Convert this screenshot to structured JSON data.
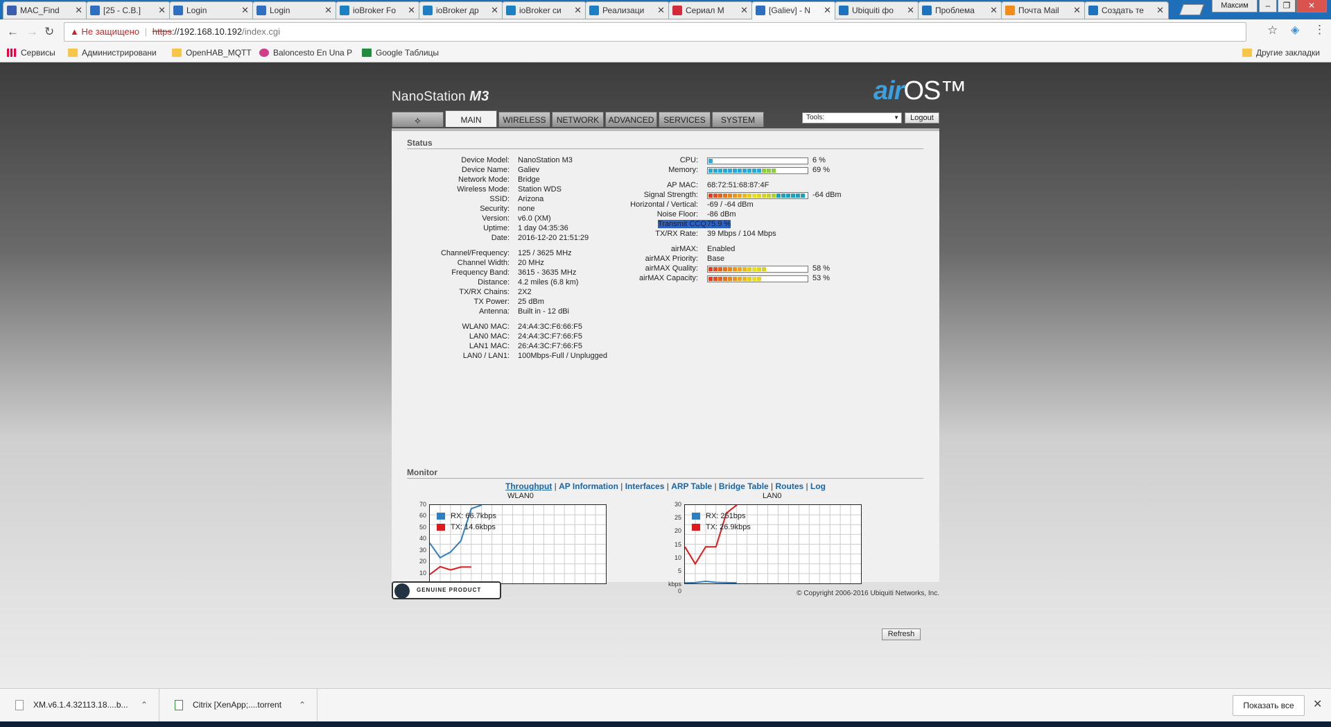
{
  "browser": {
    "tabs": [
      {
        "title": "MAC_Find",
        "icon": "mac-find-icon",
        "color": "#3a5fb0"
      },
      {
        "title": "[25 - C.B.]",
        "icon": "rss-icon",
        "color": "#2e6fc2"
      },
      {
        "title": "Login",
        "icon": "rss-icon",
        "color": "#2e6fc2"
      },
      {
        "title": "Login",
        "icon": "rss-icon",
        "color": "#2e6fc2"
      },
      {
        "title": "ioBroker Fo",
        "icon": "iobroker-icon",
        "color": "#1b80c4"
      },
      {
        "title": "ioBroker др",
        "icon": "iobroker-icon",
        "color": "#1b80c4"
      },
      {
        "title": "ioBroker си",
        "icon": "iobroker-icon",
        "color": "#1b80c4"
      },
      {
        "title": "Реализаци",
        "icon": "iobroker-icon",
        "color": "#1b80c4"
      },
      {
        "title": "Сериал М",
        "icon": "ivi-icon",
        "color": "#d42b3b"
      },
      {
        "title": "[Galiev] - N",
        "icon": "rss-icon",
        "color": "#2e6fc2",
        "active": true
      },
      {
        "title": "Ubiquiti фо",
        "icon": "ubiquiti-icon",
        "color": "#1e73be"
      },
      {
        "title": "Проблема",
        "icon": "ubiquiti-icon",
        "color": "#1e73be"
      },
      {
        "title": "Почта Mail",
        "icon": "mail-icon",
        "color": "#f28c1b"
      },
      {
        "title": "Создать те",
        "icon": "ubiquiti-icon",
        "color": "#1e73be"
      }
    ],
    "user": "Максим",
    "address": {
      "security_label": "Не защищено",
      "scheme": "https",
      "domain": "://192.168.10.192",
      "path": "/index.cgi"
    },
    "bookmarks": [
      {
        "label": "Сервисы",
        "icon": "apps-icon"
      },
      {
        "label": "Администрировани",
        "icon": "folder-icon"
      },
      {
        "label": "OpenHAB_MQTT",
        "icon": "folder-icon"
      },
      {
        "label": "Baloncesto En Una Pl",
        "icon": "basketball-icon"
      },
      {
        "label": "Google Таблицы",
        "icon": "sheets-icon"
      }
    ],
    "other_bookmarks": "Другие закладки"
  },
  "device": {
    "brand_name": "NanoStation",
    "brand_model": "M3",
    "logo_air": "air",
    "logo_os": "OS™",
    "nav_tabs": [
      "MAIN",
      "WIRELESS",
      "NETWORK",
      "ADVANCED",
      "SERVICES",
      "SYSTEM"
    ],
    "tools_label": "Tools:",
    "logout_label": "Logout",
    "status_title": "Status",
    "left_status": [
      {
        "label": "Device Model:",
        "value": "NanoStation M3"
      },
      {
        "label": "Device Name:",
        "value": "Galiev"
      },
      {
        "label": "Network Mode:",
        "value": "Bridge"
      },
      {
        "label": "Wireless Mode:",
        "value": "Station WDS"
      },
      {
        "label": "SSID:",
        "value": "Arizona"
      },
      {
        "label": "Security:",
        "value": "none"
      },
      {
        "label": "Version:",
        "value": "v6.0 (XM)"
      },
      {
        "label": "Uptime:",
        "value": "1 day 04:35:36"
      },
      {
        "label": "Date:",
        "value": "2016-12-20 21:51:29"
      },
      {
        "label": "Channel/Frequency:",
        "value": "125 / 3625 MHz"
      },
      {
        "label": "Channel Width:",
        "value": "20 MHz"
      },
      {
        "label": "Frequency Band:",
        "value": "3615 - 3635 MHz"
      },
      {
        "label": "Distance:",
        "value": "4.2 miles (6.8 km)"
      },
      {
        "label": "TX/RX Chains:",
        "value": "2X2"
      },
      {
        "label": "TX Power:",
        "value": "25 dBm"
      },
      {
        "label": "Antenna:",
        "value": "Built in - 12 dBi"
      },
      {
        "label": "WLAN0 MAC:",
        "value": "24:A4:3C:F6:66:F5"
      },
      {
        "label": "LAN0 MAC:",
        "value": "24:A4:3C:F7:66:F5"
      },
      {
        "label": "LAN1 MAC:",
        "value": "26:A4:3C:F7:66:F5"
      },
      {
        "label": "LAN0 / LAN1:",
        "value": "100Mbps-Full / Unplugged"
      }
    ],
    "right_status": {
      "cpu": {
        "label": "CPU:",
        "text": "6 %",
        "level": 0.06
      },
      "memory": {
        "label": "Memory:",
        "text": "69 %",
        "level": 0.69
      },
      "ap_mac": {
        "label": "AP MAC:",
        "value": "68:72:51:68:87:4F"
      },
      "signal": {
        "label": "Signal Strength:",
        "text": "-64 dBm",
        "level": 1.0
      },
      "hv": {
        "label": "Horizontal / Vertical:",
        "value": "-69 / -64 dBm"
      },
      "noise": {
        "label": "Noise Floor:",
        "value": "-86 dBm"
      },
      "ccq": {
        "label": "Transmit CCQ:",
        "value": "75.9 %"
      },
      "txrx": {
        "label": "TX/RX Rate:",
        "value": "39 Mbps / 104 Mbps"
      },
      "airmax": {
        "label": "airMAX:",
        "value": "Enabled"
      },
      "airmax_priority": {
        "label": "airMAX Priority:",
        "value": "Base"
      },
      "airmax_quality": {
        "label": "airMAX Quality:",
        "text": "58 %",
        "level": 0.58
      },
      "airmax_capacity": {
        "label": "airMAX Capacity:",
        "text": "53 %",
        "level": 0.53
      }
    },
    "monitor_title": "Monitor",
    "monitor_links": [
      "Throughput",
      "AP Information",
      "Interfaces",
      "ARP Table",
      "Bridge Table",
      "Routes",
      "Log"
    ],
    "graphs": [
      {
        "title": "WLAN0",
        "yticks": [
          "70",
          "60",
          "50",
          "40",
          "30",
          "20",
          "10",
          "kbps 0"
        ],
        "ymax": 70,
        "rx_label": "RX: 66.7kbps",
        "tx_label": "TX: 14.6kbps",
        "rx": [
          36,
          23,
          28,
          38,
          66.7,
          70
        ],
        "tx": [
          8,
          15,
          12,
          14.6,
          14.6
        ]
      },
      {
        "title": "LAN0",
        "yticks": [
          "30",
          "25",
          "20",
          "15",
          "10",
          "5",
          "kbps 0"
        ],
        "ymax": 30,
        "rx_label": "RX: 251bps",
        "tx_label": "TX: 26.9kbps",
        "rx": [
          0.2,
          0.3,
          0.8,
          0.4,
          0.3,
          0.25
        ],
        "tx": [
          14,
          7.5,
          14,
          14,
          26.9,
          30
        ]
      }
    ],
    "refresh_label": "Refresh",
    "genuine_label": "GENUINE PRODUCT",
    "copyright": "© Copyright 2006-2016 Ubiquiti Networks, Inc.",
    "colors": {
      "rx": "#2e7fc0",
      "tx": "#e01a1a"
    }
  },
  "downloads": {
    "items": [
      "XM.v6.1.4.32113.18....b...",
      "Citrix [XenApp;....torrent"
    ],
    "show_all": "Показать все"
  }
}
